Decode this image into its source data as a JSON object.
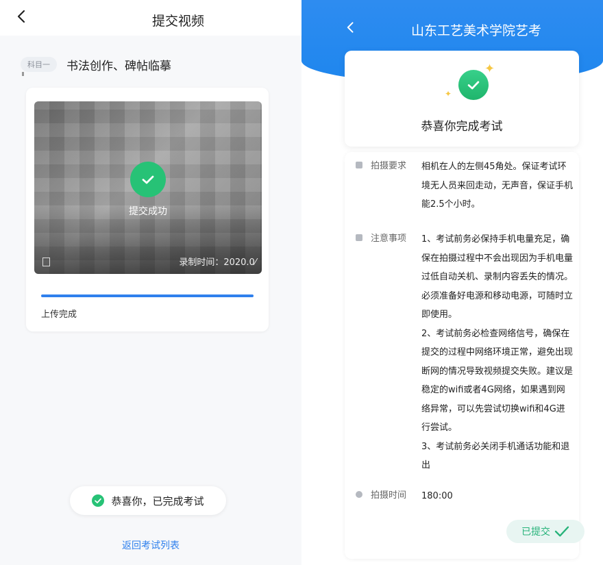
{
  "left_screen": {
    "header": {
      "back_icon": "chevron-left-icon",
      "title": "提交视频"
    },
    "subject": {
      "tag": "科目一",
      "name": "书法创作、碑帖临摹"
    },
    "video": {
      "success_text": "提交成功",
      "recording_time": "录制时间：2020.0⁄",
      "progress": 1.0,
      "upload_status": "上传完成"
    },
    "completion_pill": "恭喜你，已完成考试",
    "back_link": "返回考试列表"
  },
  "right_screen": {
    "header": {
      "back_icon": "chevron-left-icon",
      "title": "山东工艺美术学院艺考"
    },
    "congrats_text": "恭喜你完成考试",
    "requirements": {
      "label": "拍摄要求",
      "value": "相机在人的左侧45角处。保证考试环境无人员来回走动，无声音，保证手机能2.5个小时。"
    },
    "notes": {
      "label": "注意事项",
      "paragraphs": [
        "1、考试前务必保持手机电量充足，确保在拍摄过程中不会出现因为手机电量过低自动关机、录制内容丢失的情况。必须准备好电源和移动电源，可随时立即使用。",
        "2、考试前务必检查网络信号，确保在提交的过程中网络环境正常，避免出现断网的情况导致视频提交失败。建议是稳定的wifi或者4G网络，如果遇到网络异常，可以先尝试切换wifi和4G进行尝试。",
        "3、考试前务必关闭手机通话功能和退出"
      ]
    },
    "duration": {
      "label": "拍摄时间",
      "value": "180:00"
    },
    "submitted_button": "已提交"
  },
  "colors": {
    "primary_blue": "#2f80ed",
    "header_blue": "#1e86ee",
    "success_green": "#27c276",
    "submitted_bg": "#e8f5f2",
    "submitted_text": "#27b37a",
    "sparkle": "#f6c744"
  }
}
